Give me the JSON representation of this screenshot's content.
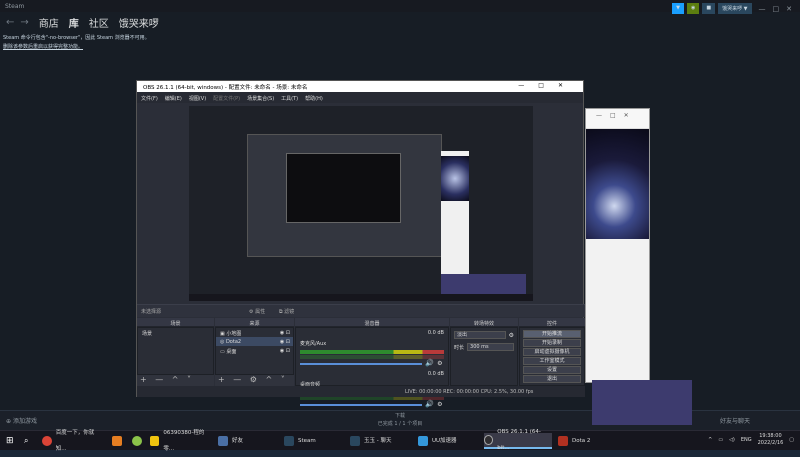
{
  "steam": {
    "top_label": "Steam",
    "back": "←",
    "forward": "→",
    "nav": [
      "商店",
      "库",
      "社区",
      "饿哭来啰"
    ],
    "top_buttons": [
      "▼",
      "◉",
      "■",
      "饿哭来啰 ▼"
    ],
    "window_controls": [
      "—",
      "□",
      "✕"
    ],
    "message": "Steam 命令行包含\"-no-browser\"，因此 Steam 浏览器不可用。",
    "link": "删除该参数后重启以获得完整功能。",
    "add_game": "添加游戏",
    "downloads": "下载",
    "downloads_sub": "已完成 1 / 1 个项目",
    "friends": "好友与聊天"
  },
  "obs": {
    "title": "OBS 26.1.1 (64-bit, windows) - 配置文件: 未命名 - 场景: 未命名",
    "window_controls": [
      "—",
      "□",
      "✕"
    ],
    "menu": [
      "文件(F)",
      "编辑(E)",
      "视图(V)",
      "配置文件(P)",
      "场景集合(S)",
      "工具(T)",
      "帮助(H)"
    ],
    "source_strip": "未选择源",
    "properties": "属性",
    "filters": "滤镜",
    "panels": {
      "scenes": "场景",
      "sources": "来源",
      "mixer": "混音器",
      "transitions": "转场特效",
      "controls": "控件"
    },
    "scene_item": "场景",
    "sources": [
      "小地图",
      "Dota2",
      "桌面"
    ],
    "mixer": [
      {
        "name": "麦克风/Aux",
        "db": "0.0 dB"
      },
      {
        "name": "桌面音频",
        "db": "0.0 dB"
      }
    ],
    "transition": "淡出",
    "duration_label": "时长",
    "duration_value": "300 ms",
    "controls": [
      "开始推流",
      "开始录制",
      "启动虚拟摄像机",
      "工作室模式",
      "设置",
      "退出"
    ],
    "tool_glyphs": "+ — ^ ˅",
    "status": "LIVE: 00:00:00    REC: 00:00:00    CPU: 2.5%, 30.00 fps"
  },
  "taskbar": {
    "items": [
      {
        "label": "",
        "color": "#2d89ef"
      },
      {
        "label": "百度一下，你就知...",
        "color": "#db4437"
      },
      {
        "label": "",
        "color": "#e67e22"
      },
      {
        "label": "",
        "color": "#8bc34a"
      },
      {
        "label": "06390380-程的零...",
        "color": "#f1c40f"
      },
      {
        "label": "好友",
        "color": "#4a6fa5"
      },
      {
        "label": "Steam",
        "color": "#2a475e"
      },
      {
        "label": "玉玉 - 聊天",
        "color": "#2a475e"
      },
      {
        "label": "UU加速器",
        "color": "#3498db"
      },
      {
        "label": "OBS 26.1.1 (64-bit...",
        "color": "#302e31"
      },
      {
        "label": "Dota 2",
        "color": "#b23121"
      }
    ],
    "tray_lang": "ENG",
    "time": "19:38:00",
    "date": "2022/2/16"
  }
}
